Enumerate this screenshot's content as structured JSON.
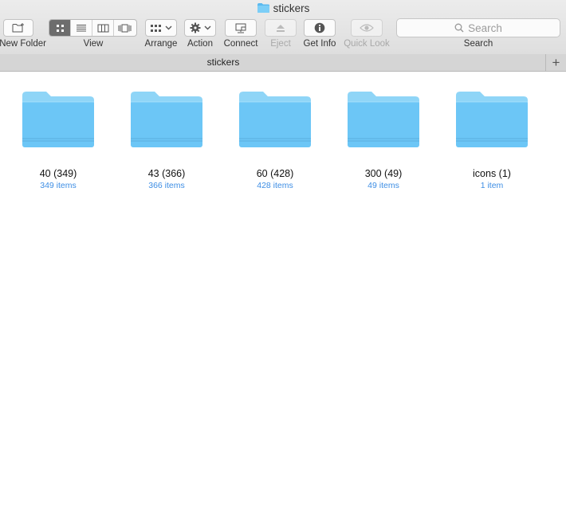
{
  "window": {
    "title": "stickers"
  },
  "toolbar": {
    "new_folder": "New Folder",
    "view": "View",
    "arrange": "Arrange",
    "action": "Action",
    "connect": "Connect",
    "eject": "Eject",
    "get_info": "Get Info",
    "quick_look": "Quick Look",
    "search_label": "Search",
    "search_placeholder": "Search"
  },
  "tab": {
    "label": "stickers",
    "add": "+"
  },
  "items": [
    {
      "name": "40 (349)",
      "count": "349 items"
    },
    {
      "name": "43 (366)",
      "count": "366 items"
    },
    {
      "name": "60 (428)",
      "count": "428 items"
    },
    {
      "name": "300 (49)",
      "count": "49 items"
    },
    {
      "name": "icons (1)",
      "count": "1 item"
    }
  ],
  "colors": {
    "accent": "#3e8ee4",
    "folder": "#6cc6f6",
    "folder_tab": "#7fd0f7"
  },
  "icons": [
    "folder-icon",
    "new-folder-icon",
    "icon-view-icon",
    "list-view-icon",
    "column-view-icon",
    "cover-flow-icon",
    "arrange-icon",
    "gear-icon",
    "connect-icon",
    "eject-icon",
    "info-icon",
    "eye-icon",
    "search-icon",
    "plus-icon"
  ]
}
